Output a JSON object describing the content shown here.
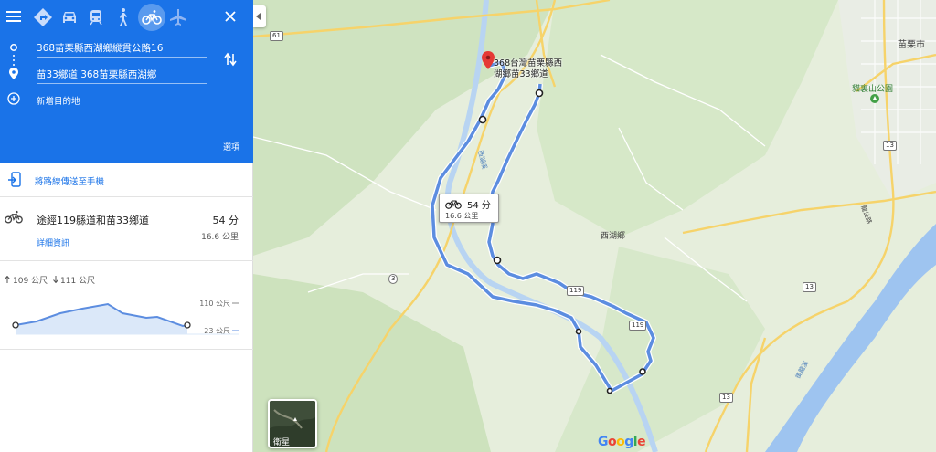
{
  "directions": {
    "from": "368苗栗縣西湖鄉縱貫公路16",
    "to": "苗33鄉道 368苗栗縣西湖鄉",
    "add_destination": "新增目的地",
    "options": "選項",
    "send_to_phone": "將路線傳送至手機"
  },
  "route": {
    "name": "途經119縣道和苗33鄉道",
    "time": "54 分",
    "distance": "16.6 公里",
    "details": "詳細資訊"
  },
  "elevation": {
    "ascent": "109 公尺",
    "descent": "111 公尺",
    "max": "110 公尺",
    "min": "23 公尺"
  },
  "map": {
    "route_box_time": "54 分",
    "route_box_distance": "16.6 公里",
    "destination_label": "368台灣苗栗縣西湖鄉苗33鄉道",
    "labels": {
      "miaoli_city": "苗栗市",
      "park": "貓裏山公園",
      "xihu": "西湖鄉",
      "river": "西湖溪",
      "river_lower": "後龍溪",
      "district_vert": "龍公路"
    },
    "shields": [
      "61",
      "119",
      "119",
      "13",
      "13",
      "13",
      "3"
    ],
    "satellite_label": "衛星",
    "google": "Google",
    "colors": {
      "route": "#5c8de0",
      "water": "#9ec4f0",
      "roads": "#f6d36a",
      "accent": "#1a73e8"
    }
  }
}
